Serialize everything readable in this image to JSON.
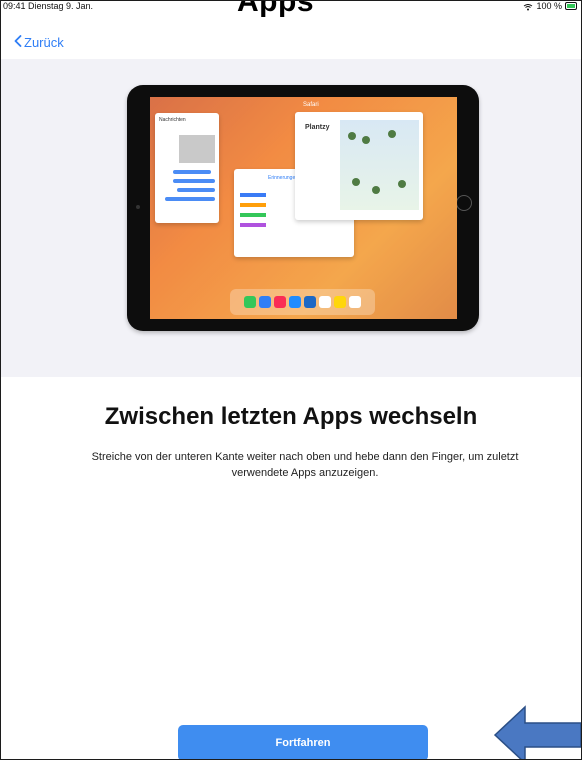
{
  "window": {
    "top_heading_cut": "Apps"
  },
  "status_bar": {
    "time_date": "09:41  Dienstag 9. Jan.",
    "battery": "100 %"
  },
  "nav": {
    "back_label": "Zurück"
  },
  "hero": {
    "screen_messages": "Nachrichten",
    "screen_reminders": "Erinnerungen",
    "screen_safari": "Safari",
    "screen_plants": "Plantzy"
  },
  "content": {
    "title": "Zwischen letzten Apps wechseln",
    "subtitle": "Streiche von der unteren Kante weiter nach oben und hebe dann den Finger, um zuletzt verwendete Apps anzuzeigen."
  },
  "footer": {
    "continue_label": "Fortfahren"
  },
  "colors": {
    "accent": "#3f8df0",
    "back_link": "#2f7ef6",
    "hero_bg": "#f2f2f7"
  },
  "icons": {
    "back": "chevron-left-icon",
    "wifi": "wifi-icon",
    "battery": "battery-icon",
    "annotation_arrow": "left-arrow-icon"
  }
}
